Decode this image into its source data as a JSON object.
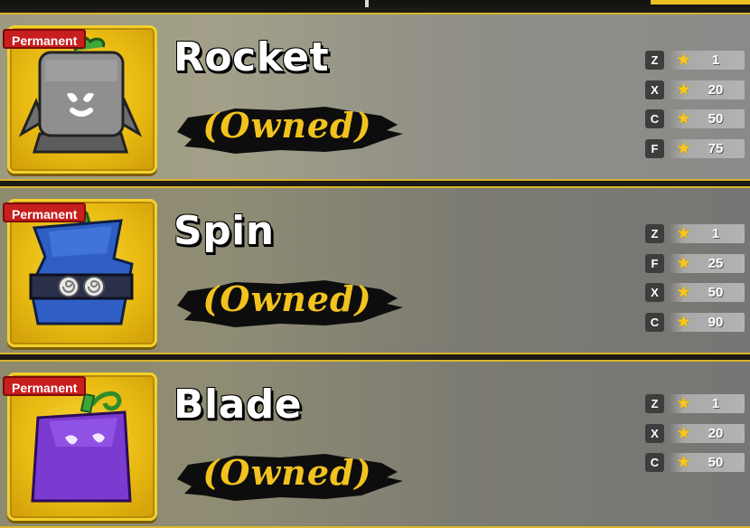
{
  "colors": {
    "accent": "#e8c020",
    "owned_text": "#f2c21e",
    "badge": "#c81e1e"
  },
  "items": [
    {
      "name": "Rocket",
      "status": "(Owned)",
      "badge": "Permanent",
      "icon": "rocket-fruit-icon",
      "moves": [
        {
          "key": "Z",
          "level": "1"
        },
        {
          "key": "X",
          "level": "20"
        },
        {
          "key": "C",
          "level": "50"
        },
        {
          "key": "F",
          "level": "75"
        }
      ]
    },
    {
      "name": "Spin",
      "status": "(Owned)",
      "badge": "Permanent",
      "icon": "spin-fruit-icon",
      "moves": [
        {
          "key": "Z",
          "level": "1"
        },
        {
          "key": "F",
          "level": "25"
        },
        {
          "key": "X",
          "level": "50"
        },
        {
          "key": "C",
          "level": "90"
        }
      ]
    },
    {
      "name": "Blade",
      "status": "(Owned)",
      "badge": "Permanent",
      "icon": "blade-fruit-icon",
      "moves": [
        {
          "key": "Z",
          "level": "1"
        },
        {
          "key": "X",
          "level": "20"
        },
        {
          "key": "C",
          "level": "50"
        }
      ]
    }
  ]
}
